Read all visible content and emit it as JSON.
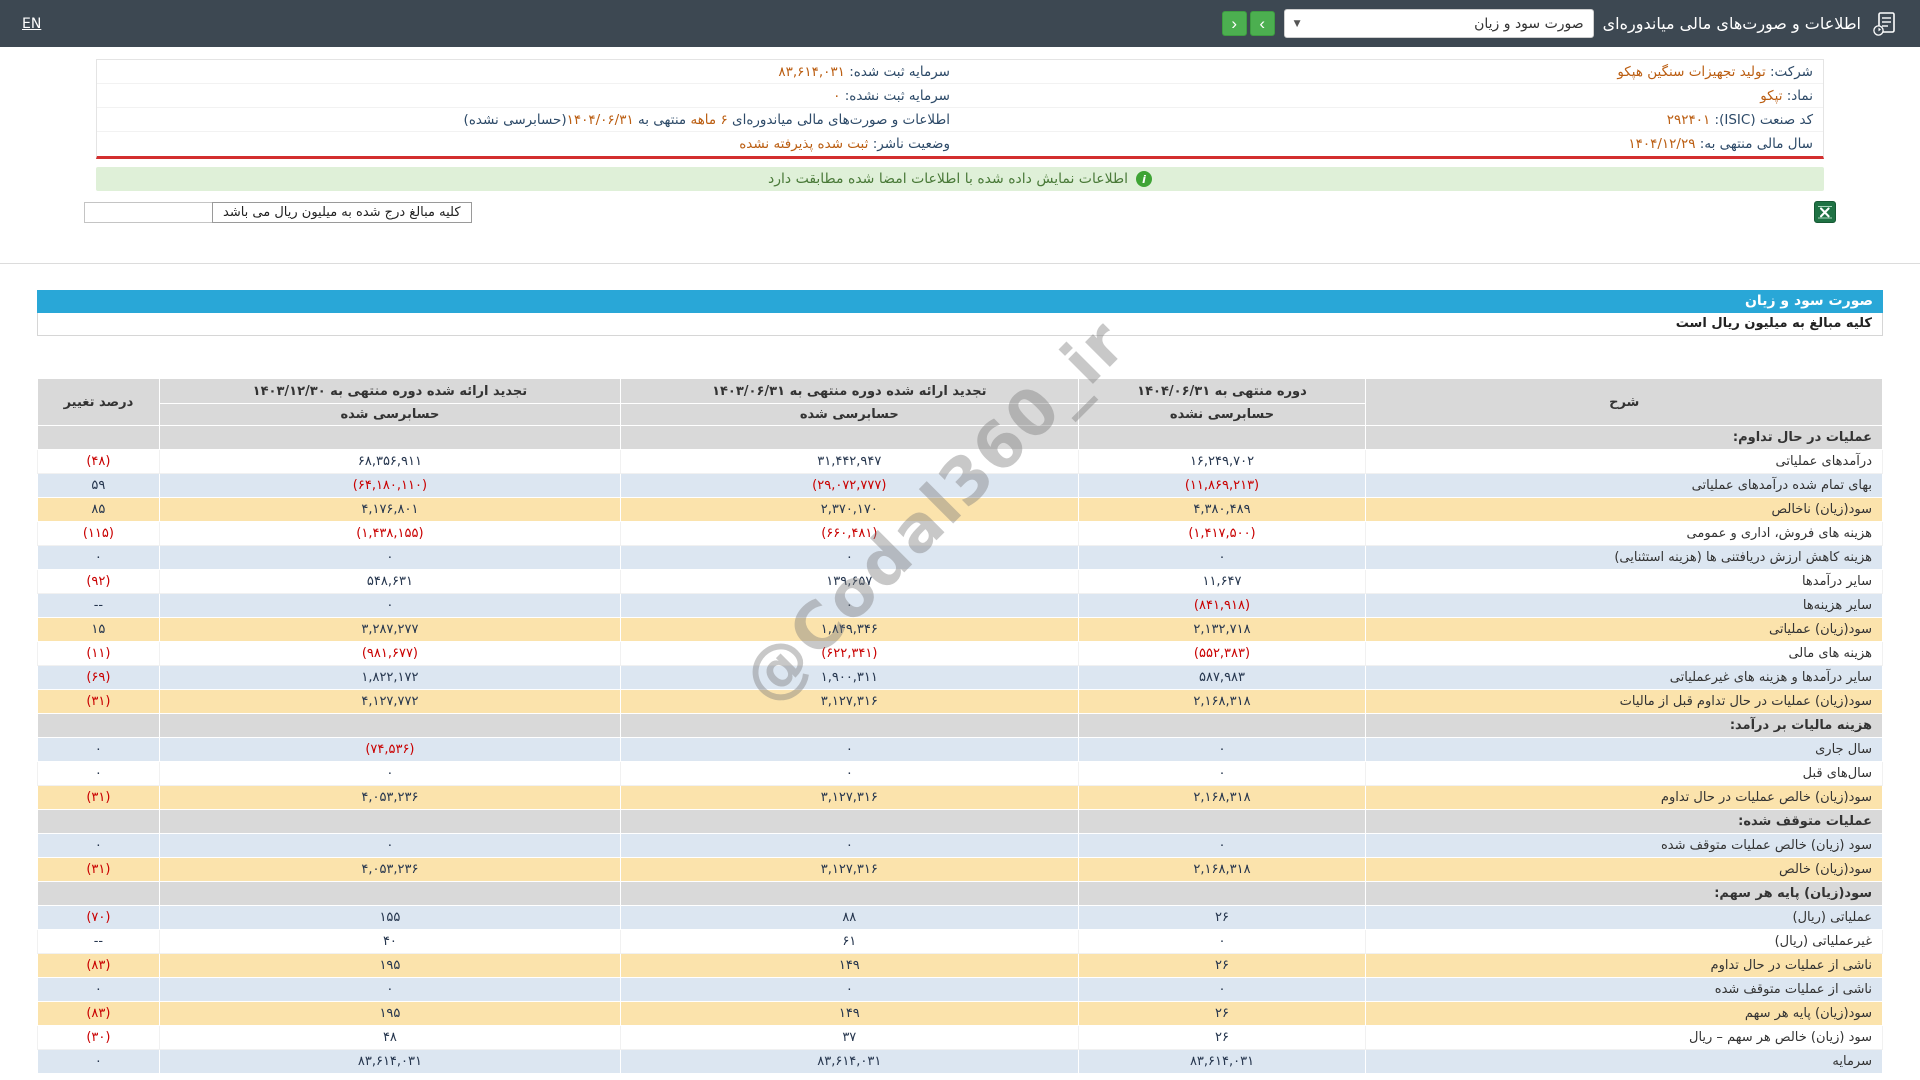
{
  "topbar": {
    "title": "اطلاعات و صورت‌های مالی میاندوره‌ای",
    "report_select": {
      "value": "صورت سود و زیان"
    },
    "en_label": "EN"
  },
  "icons": {
    "caret_down": "▼",
    "chevron_right": "›",
    "chevron_left": "‹",
    "info": "i"
  },
  "company_info": {
    "rows": [
      {
        "right": {
          "label": "شرکت:",
          "value": "تولید تجهیزات سنگین هپکو"
        },
        "left": {
          "label": "سرمایه ثبت شده:",
          "value": "۸۳,۶۱۴,۰۳۱"
        }
      },
      {
        "right": {
          "label": "نماد:",
          "value": "تپکو"
        },
        "left": {
          "label": "سرمایه ثبت نشده:",
          "value": "۰"
        }
      },
      {
        "right": {
          "label": "کد صنعت (ISIC):",
          "value": "۲۹۲۴۰۱"
        },
        "left": {
          "parts": [
            {
              "text": "اطلاعات و صورت‌های مالی میاندوره‌ای ",
              "style": "label"
            },
            {
              "text": "۶ ماهه",
              "style": "accent"
            },
            {
              "text": " منتهی به ",
              "style": "label"
            },
            {
              "text": "۱۴۰۴/۰۶/۳۱",
              "style": "accent"
            },
            {
              "text": "(حسابرسی نشده)",
              "style": "label"
            }
          ]
        }
      },
      {
        "right": {
          "label": "سال مالی منتهی به:",
          "value": "۱۴۰۴/۱۲/۲۹"
        },
        "left": {
          "label": "وضعیت ناشر:",
          "value": "ثبت شده پذیرفته نشده"
        }
      }
    ]
  },
  "banner": {
    "text": "اطلاعات نمایش داده شده با اطلاعات امضا شده مطابقت دارد"
  },
  "toolbar": {
    "unit_note": "کلیه مبالغ درج شده به میلیون ریال می باشد"
  },
  "statement": {
    "title": "صورت سود و زیان",
    "unit_line": "کلیه مبالغ به میلیون ریال است",
    "table": {
      "desc_header": "شرح",
      "change_header": "درصد تغییر",
      "period_headers": [
        {
          "title": "دوره منتهی به ۱۴۰۴/۰۶/۳۱",
          "audit": "حسابرسی نشده"
        },
        {
          "title": "تجدید ارائه شده دوره منتهی به ۱۴۰۳/۰۶/۳۱",
          "audit": "حسابرسی شده"
        },
        {
          "title": "تجدید ارائه شده دوره منتهی به ۱۴۰۳/۱۲/۳۰",
          "audit": "حسابرسی شده"
        }
      ],
      "rows": [
        {
          "type": "section",
          "label": "عملیات در حال تداوم:"
        },
        {
          "type": "data",
          "style": "white",
          "label": "درآمدهای عملیاتی",
          "values": [
            "۱۶,۲۴۹,۷۰۲",
            "۳۱,۴۴۲,۹۴۷",
            "۶۸,۳۵۶,۹۱۱"
          ],
          "change": "(۴۸)"
        },
        {
          "type": "data",
          "style": "blue",
          "label": "بهای تمام شده درآمدهای عملیاتی",
          "values": [
            "(۱۱,۸۶۹,۲۱۳)",
            "(۲۹,۰۷۲,۷۷۷)",
            "(۶۴,۱۸۰,۱۱۰)"
          ],
          "change": "۵۹"
        },
        {
          "type": "data",
          "style": "yellow",
          "label": "سود(زیان) ناخالص",
          "values": [
            "۴,۳۸۰,۴۸۹",
            "۲,۳۷۰,۱۷۰",
            "۴,۱۷۶,۸۰۱"
          ],
          "change": "۸۵"
        },
        {
          "type": "data",
          "style": "white",
          "label": "هزینه های فروش، اداری و عمومی",
          "values": [
            "(۱,۴۱۷,۵۰۰)",
            "(۶۶۰,۴۸۱)",
            "(۱,۴۳۸,۱۵۵)"
          ],
          "change": "(۱۱۵)"
        },
        {
          "type": "data",
          "style": "blue",
          "label": "هزینه کاهش ارزش دریافتنی ها (هزینه استثنایی)",
          "values": [
            "۰",
            "۰",
            "۰"
          ],
          "change": "۰"
        },
        {
          "type": "data",
          "style": "white",
          "label": "سایر درآمدها",
          "values": [
            "۱۱,۶۴۷",
            "۱۳۹,۶۵۷",
            "۵۴۸,۶۳۱"
          ],
          "change": "(۹۲)"
        },
        {
          "type": "data",
          "style": "blue",
          "label": "سایر هزینه‌ها",
          "values": [
            "(۸۴۱,۹۱۸)",
            "۰",
            "۰"
          ],
          "change": "--"
        },
        {
          "type": "data",
          "style": "yellow",
          "label": "سود(زیان) عملیاتی",
          "values": [
            "۲,۱۳۲,۷۱۸",
            "۱,۸۴۹,۳۴۶",
            "۳,۲۸۷,۲۷۷"
          ],
          "change": "۱۵"
        },
        {
          "type": "data",
          "style": "white",
          "label": "هزینه های مالی",
          "values": [
            "(۵۵۲,۳۸۳)",
            "(۶۲۲,۳۴۱)",
            "(۹۸۱,۶۷۷)"
          ],
          "change": "(۱۱)"
        },
        {
          "type": "data",
          "style": "blue",
          "label": "سایر درآمدها و هزینه های غیرعملیاتی",
          "values": [
            "۵۸۷,۹۸۳",
            "۱,۹۰۰,۳۱۱",
            "۱,۸۲۲,۱۷۲"
          ],
          "change": "(۶۹)"
        },
        {
          "type": "data",
          "style": "yellow",
          "label": "سود(زیان) عملیات در حال تداوم قبل از مالیات",
          "values": [
            "۲,۱۶۸,۳۱۸",
            "۳,۱۲۷,۳۱۶",
            "۴,۱۲۷,۷۷۲"
          ],
          "change": "(۳۱)"
        },
        {
          "type": "section",
          "label": "هزینه مالیات بر درآمد:"
        },
        {
          "type": "data",
          "style": "blue",
          "label": "سال جاری",
          "values": [
            "۰",
            "۰",
            "(۷۴,۵۳۶)"
          ],
          "change": "۰"
        },
        {
          "type": "data",
          "style": "white",
          "label": "سال‌های قبل",
          "values": [
            "۰",
            "۰",
            "۰"
          ],
          "change": "۰"
        },
        {
          "type": "data",
          "style": "yellow",
          "label": "سود(زیان) خالص عملیات در حال تداوم",
          "values": [
            "۲,۱۶۸,۳۱۸",
            "۳,۱۲۷,۳۱۶",
            "۴,۰۵۳,۲۳۶"
          ],
          "change": "(۳۱)"
        },
        {
          "type": "section",
          "label": "عملیات متوقف شده:"
        },
        {
          "type": "data",
          "style": "blue",
          "label": "سود (زیان) خالص عملیات متوقف شده",
          "values": [
            "۰",
            "۰",
            "۰"
          ],
          "change": "۰"
        },
        {
          "type": "data",
          "style": "yellow",
          "label": "سود(زیان) خالص",
          "values": [
            "۲,۱۶۸,۳۱۸",
            "۳,۱۲۷,۳۱۶",
            "۴,۰۵۳,۲۳۶"
          ],
          "change": "(۳۱)"
        },
        {
          "type": "section",
          "label": "سود(زیان) پایه هر سهم:"
        },
        {
          "type": "data",
          "style": "blue",
          "label": "عملیاتی (ریال)",
          "values": [
            "۲۶",
            "۸۸",
            "۱۵۵"
          ],
          "change": "(۷۰)"
        },
        {
          "type": "data",
          "style": "white",
          "label": "غیرعملیاتی (ریال)",
          "values": [
            "۰",
            "۶۱",
            "۴۰"
          ],
          "change": "--"
        },
        {
          "type": "data",
          "style": "yellow",
          "label": "ناشی از عملیات در حال تداوم",
          "values": [
            "۲۶",
            "۱۴۹",
            "۱۹۵"
          ],
          "change": "(۸۳)"
        },
        {
          "type": "data",
          "style": "blue",
          "label": "ناشی از عملیات متوقف شده",
          "values": [
            "۰",
            "۰",
            "۰"
          ],
          "change": "۰"
        },
        {
          "type": "data",
          "style": "yellow",
          "label": "سود(زیان) پایه هر سهم",
          "values": [
            "۲۶",
            "۱۴۹",
            "۱۹۵"
          ],
          "change": "(۸۳)"
        },
        {
          "type": "data",
          "style": "white",
          "label": "سود (زیان) خالص هر سهم – ریال",
          "values": [
            "۲۶",
            "۳۷",
            "۴۸"
          ],
          "change": "(۳۰)"
        },
        {
          "type": "data",
          "style": "blue",
          "label": "سرمایه",
          "values": [
            "۸۳,۶۱۴,۰۳۱",
            "۸۳,۶۱۴,۰۳۱",
            "۸۳,۶۱۴,۰۳۱"
          ],
          "change": "۰"
        }
      ]
    }
  },
  "watermark": "@Codal360_ir",
  "colors": {
    "topbar_bg": "#3d4852",
    "nav_green": "#4caf50",
    "banner_bg": "#dff0d8",
    "banner_text": "#4a7a39",
    "title_bar_blue": "#29a7d7",
    "row_blue": "#dce6f1",
    "row_yellow": "#fbe3ac",
    "section_gray": "#d9d9d9",
    "negative_red": "#c90000",
    "accent_orange": "#bb5e12",
    "red_divider": "#d32f2f"
  }
}
